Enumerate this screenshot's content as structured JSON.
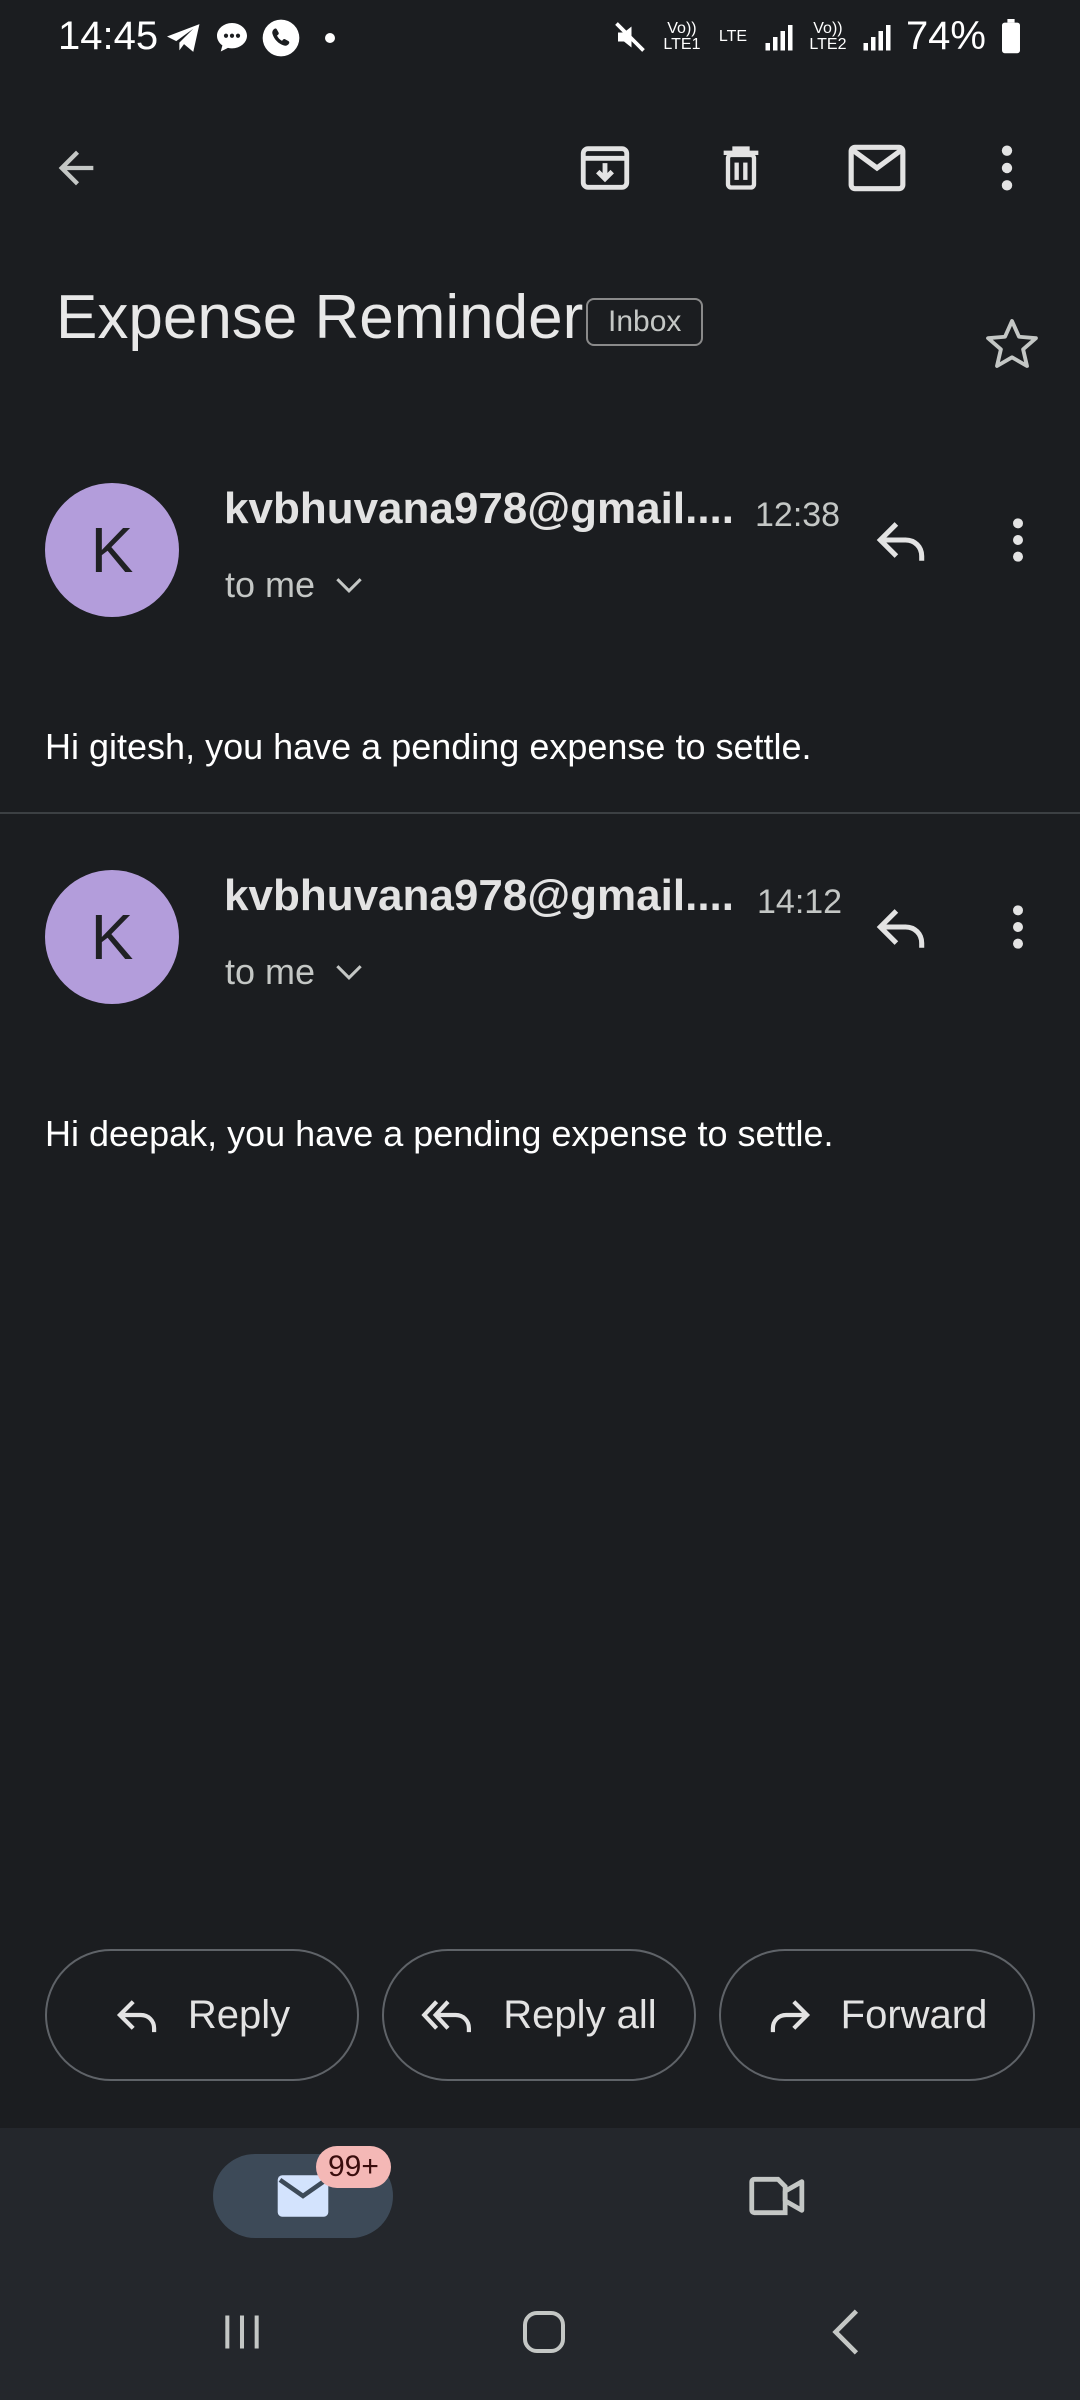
{
  "status_bar": {
    "time": "14:45",
    "battery": "74%",
    "volte1": "Vo)) LTE1",
    "lte": "LTE",
    "volte2": "Vo)) LTE2"
  },
  "toolbar": {
    "back": "arrow-back-icon",
    "archive": "archive-icon",
    "delete": "delete-icon",
    "mark_unread": "mail-icon",
    "more": "more-vert-icon"
  },
  "subject": "Expense Reminder",
  "label_badge": "Inbox",
  "messages": [
    {
      "avatar_letter": "K",
      "sender": "kvbhuvana978@gmail....",
      "time": "12:38",
      "recipient": "to me",
      "body": "Hi gitesh, you have a pending expense to settle."
    },
    {
      "avatar_letter": "K",
      "sender": "kvbhuvana978@gmail....",
      "time": "14:12",
      "recipient": "to me",
      "body": "Hi deepak, you have a pending expense to settle."
    }
  ],
  "actions": {
    "reply": "Reply",
    "reply_all": "Reply all",
    "forward": "Forward"
  },
  "bottom_nav": {
    "mail_badge": "99+"
  },
  "colors": {
    "background": "#1b1d20",
    "avatar": "#b39ddb",
    "nav_background": "#24272c",
    "active_pill": "#3d4a58",
    "badge": "#f4b8b6"
  }
}
